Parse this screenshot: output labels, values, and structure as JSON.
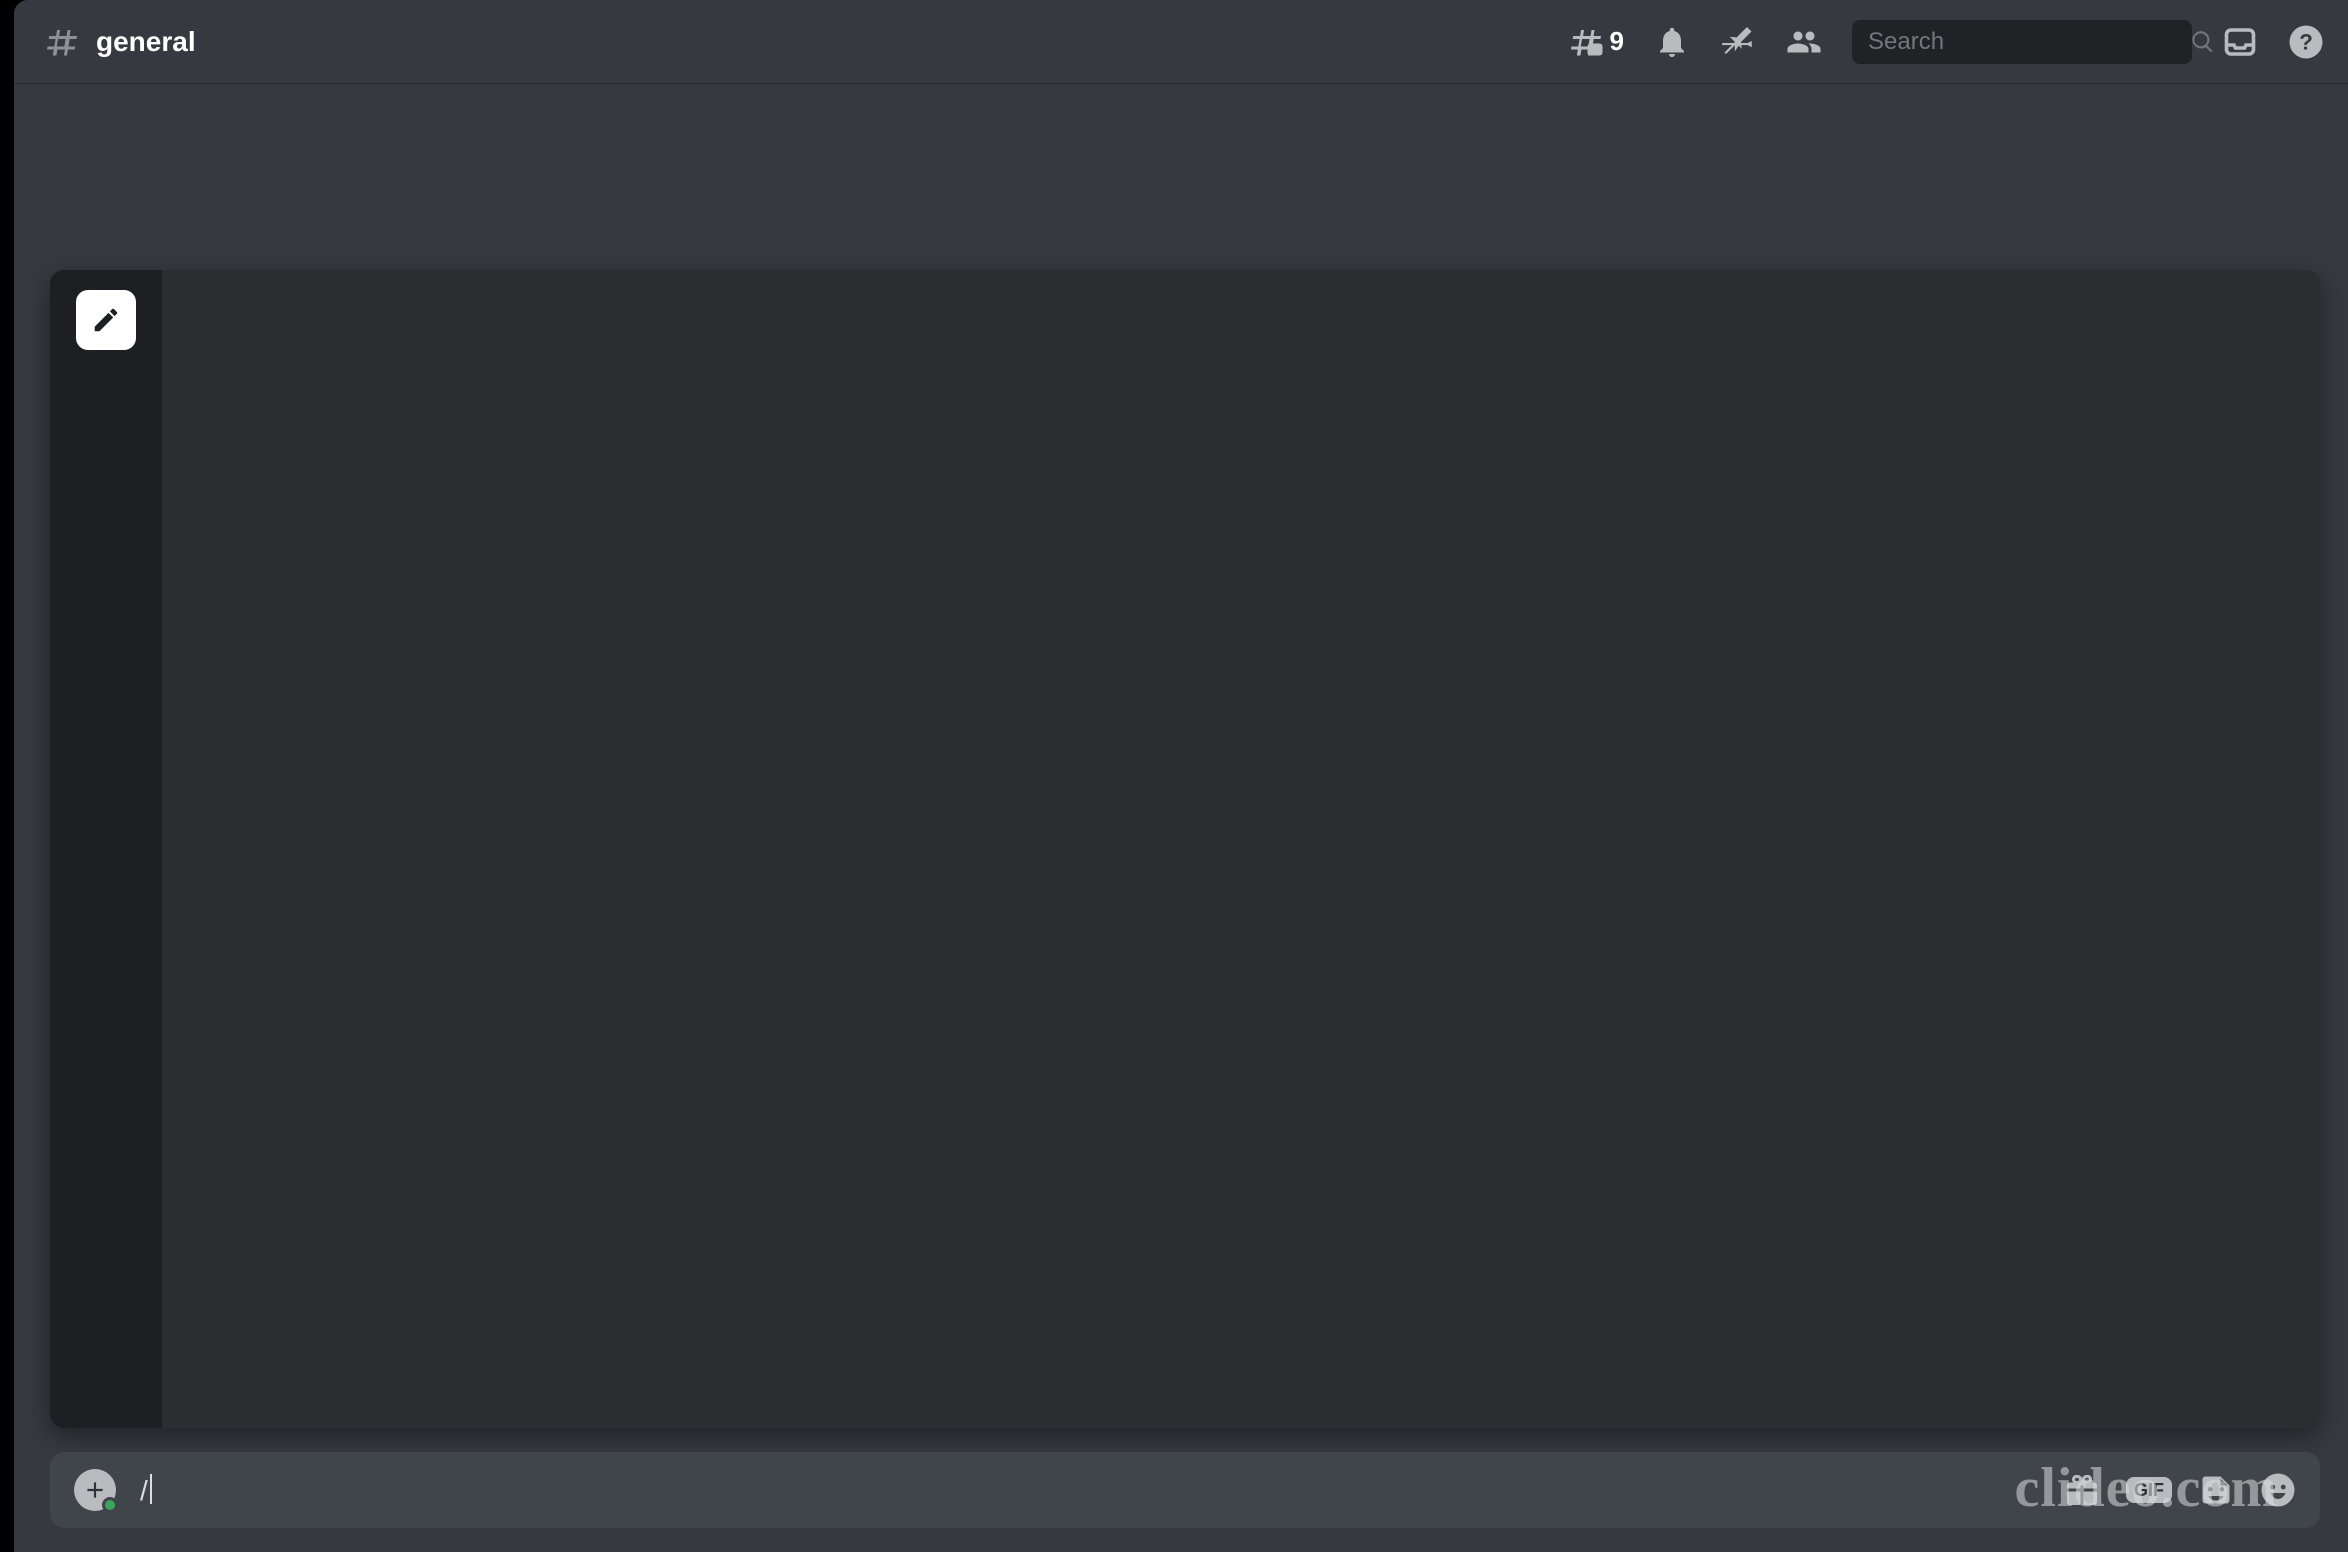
{
  "header": {
    "channel_name": "general",
    "threads_count": "9",
    "search_placeholder": "Search"
  },
  "composer": {
    "input_value": "/",
    "gif_label": "GIF"
  },
  "watermark": "clideo.com"
}
